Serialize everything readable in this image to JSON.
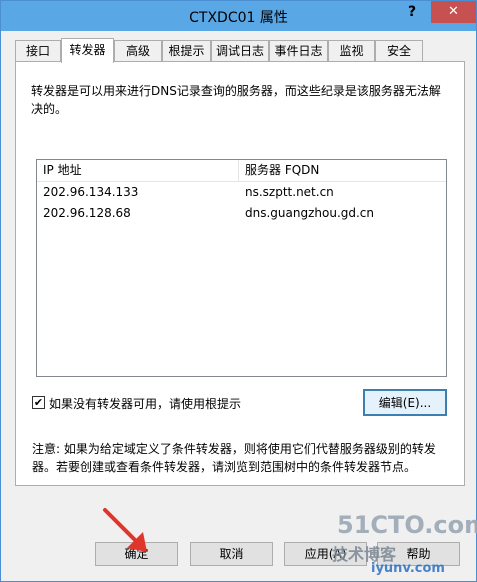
{
  "window": {
    "title": "CTXDC01 属性",
    "help_glyph": "?",
    "close_glyph": "✕"
  },
  "tabs": [
    {
      "label": "接口"
    },
    {
      "label": "转发器"
    },
    {
      "label": "高级"
    },
    {
      "label": "根提示"
    },
    {
      "label": "调试日志"
    },
    {
      "label": "事件日志"
    },
    {
      "label": "监视"
    },
    {
      "label": "安全"
    }
  ],
  "active_tab": "转发器",
  "forwarders": {
    "description": "转发器是可以用来进行DNS记录查询的服务器，而这些纪录是该服务器无法解决的。",
    "columns": [
      "IP 地址",
      "服务器 FQDN"
    ],
    "rows": [
      {
        "ip": "202.96.134.133",
        "fqdn": "ns.szptt.net.cn"
      },
      {
        "ip": "202.96.128.68",
        "fqdn": "dns.guangzhou.gd.cn"
      }
    ],
    "use_root_hints": {
      "checked": true,
      "check_glyph": "✔",
      "label": "如果没有转发器可用，请使用根提示"
    },
    "edit_button": "编辑(E)...",
    "note": "注意: 如果为给定域定义了条件转发器，则将使用它们代替服务器级别的转发器。若要创建或查看条件转发器，请浏览到范围树中的条件转发器节点。"
  },
  "footer": {
    "ok": "确定",
    "cancel": "取消",
    "apply": "应用(A)",
    "help": "帮助"
  },
  "watermark": {
    "line1": "51CTO.com",
    "line2": "技术博客",
    "line3": "iyunv.com"
  },
  "colors": {
    "titlebar": "#5aa7e6",
    "close_button": "#c75050",
    "annotation_arrow": "#e0352b"
  }
}
